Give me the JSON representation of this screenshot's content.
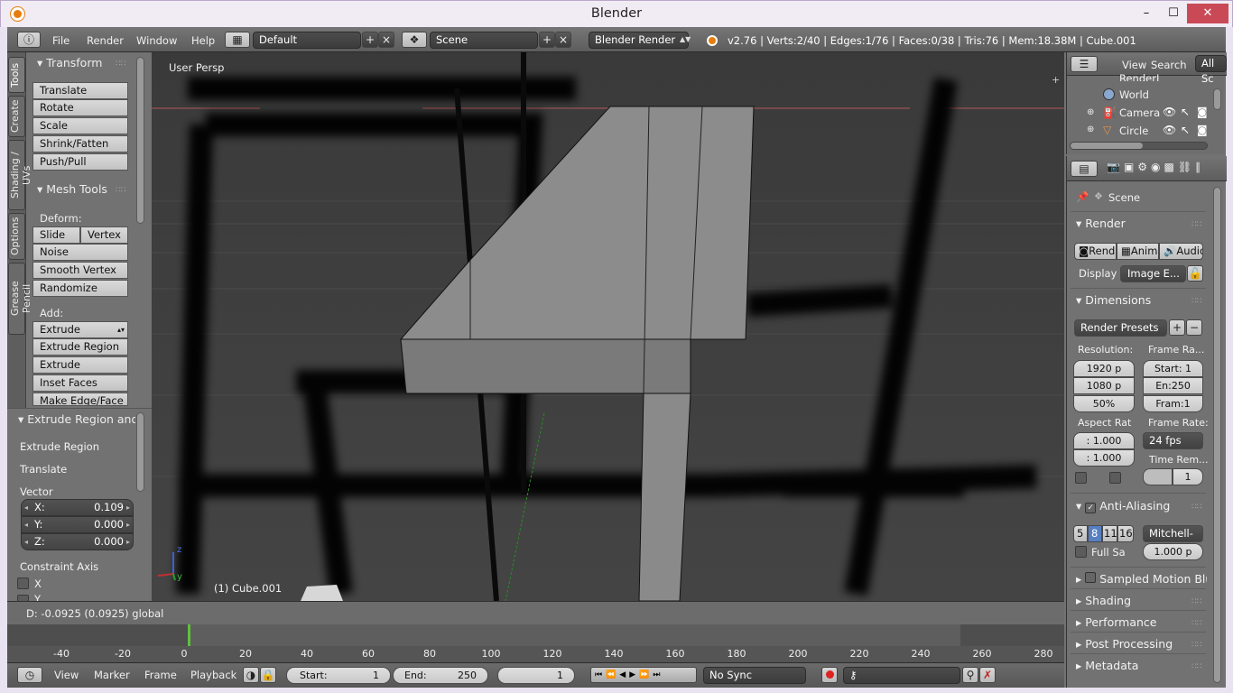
{
  "window": {
    "title": "Blender",
    "minimize": "–",
    "maximize": "☐",
    "close": "✕"
  },
  "infobar": {
    "menus": [
      "File",
      "Render",
      "Window",
      "Help"
    ],
    "screen_layout": "Default",
    "scene": "Scene",
    "render_engine": "Blender Render",
    "stats": "v2.76 | Verts:2/40 | Edges:1/76 | Faces:0/38 | Tris:76 | Mem:18.38M | Cube.001"
  },
  "tool_tabs": [
    "Tools",
    "Create",
    "Shading / UVs",
    "Options",
    "Grease Pencil"
  ],
  "tools": {
    "transform": {
      "title": "Transform",
      "buttons": [
        "Translate",
        "Rotate",
        "Scale",
        "Shrink/Fatten",
        "Push/Pull"
      ]
    },
    "mesh_tools": {
      "title": "Mesh Tools",
      "deform_label": "Deform:",
      "slide_edge": "Slide Ed",
      "vertex": "Vertex",
      "deform_buttons": [
        "Noise",
        "Smooth Vertex",
        "Randomize"
      ],
      "add_label": "Add:",
      "extrude": "Extrude",
      "add_buttons": [
        "Extrude Region",
        "Extrude Individual",
        "Inset Faces",
        "Make Edge/Face"
      ]
    }
  },
  "operator_panel": {
    "title": "Extrude Region and",
    "line1": "Extrude Region",
    "line2": "Translate",
    "vector_label": "Vector",
    "vector": [
      {
        "axis": "X:",
        "value": "0.109"
      },
      {
        "axis": "Y:",
        "value": "0.000"
      },
      {
        "axis": "Z:",
        "value": "0.000"
      }
    ],
    "constraint_label": "Constraint Axis",
    "constraint_x": "X",
    "constraint_y": "Y"
  },
  "viewport": {
    "view_name": "User Persp",
    "object_label": "(1) Cube.001",
    "axis_z": "z",
    "axis_y": "y"
  },
  "status": {
    "text": "D: -0.0925 (0.0925) global"
  },
  "timeline": {
    "ruler": [
      "-40",
      "-20",
      "0",
      "20",
      "40",
      "60",
      "80",
      "100",
      "120",
      "140",
      "160",
      "180",
      "200",
      "220",
      "240",
      "260",
      "280"
    ],
    "menus": [
      "View",
      "Marker",
      "Frame",
      "Playback"
    ],
    "start_label": "Start:",
    "start": "1",
    "end_label": "End:",
    "end": "250",
    "current": "1",
    "sync": "No Sync"
  },
  "outliner": {
    "menus": [
      "View",
      "Search"
    ],
    "filter": "All Sc",
    "items": [
      "RenderL",
      "World",
      "Camera",
      "Circle"
    ]
  },
  "properties": {
    "context": "Scene",
    "render": {
      "title": "Render",
      "render_btn": "Rend",
      "anim_btn": "Anim",
      "audio_btn": "Audio",
      "display_label": "Display",
      "display_value": "Image E..."
    },
    "dimensions": {
      "title": "Dimensions",
      "presets": "Render Presets",
      "resolution_label": "Resolution:",
      "res_x": "1920 p",
      "res_y": "1080 p",
      "res_pct": "50%",
      "frame_range_label": "Frame Ra...",
      "start": "Start: 1",
      "end": "En:250",
      "step": "Fram:1",
      "aspect_label": "Aspect Rat",
      "aspect_x": ": 1.000",
      "aspect_y": ": 1.000",
      "frame_rate_label": "Frame Rate:",
      "frame_rate": "24 fps",
      "time_remap_label": "Time Rem...",
      "time_remap": "1"
    },
    "anti_aliasing": {
      "title": "Anti-Aliasing",
      "samples": [
        "5",
        "8",
        "11",
        "16"
      ],
      "filter": "Mitchell-",
      "full_sample": "Full Sa",
      "filter_size": "1.000 p"
    },
    "collapsed_panels": [
      "Sampled Motion Blur",
      "Shading",
      "Performance",
      "Post Processing",
      "Metadata"
    ]
  }
}
